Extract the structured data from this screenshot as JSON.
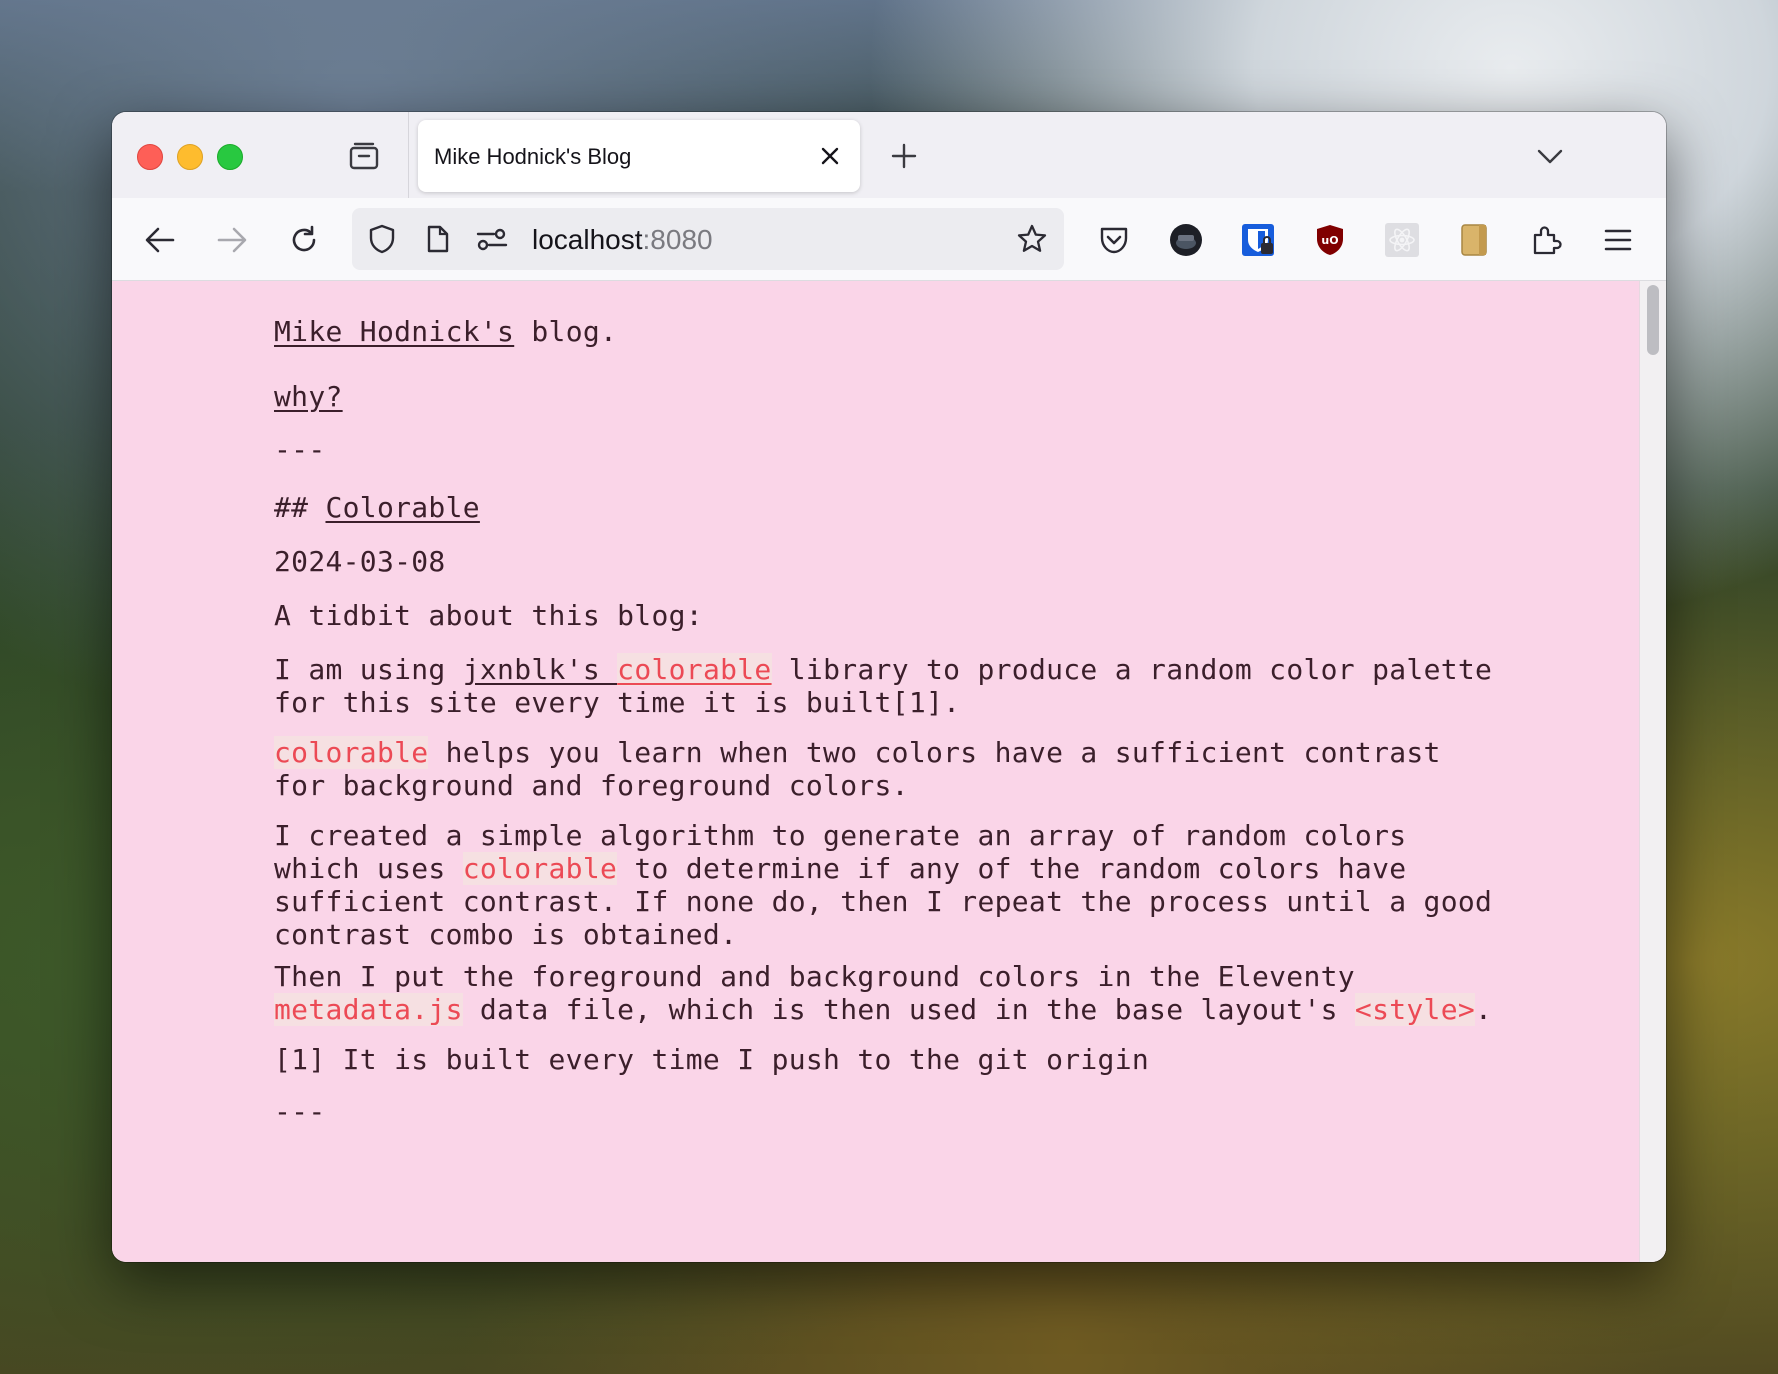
{
  "browser": {
    "tab": {
      "title": "Mike Hodnick's Blog"
    },
    "url": {
      "host": "localhost",
      "port": ":8080"
    }
  },
  "icons": [
    "tab-view-icon",
    "close-icon",
    "plus-icon",
    "chevron-down-icon",
    "back-arrow-icon",
    "forward-arrow-icon",
    "reload-icon",
    "shield-icon",
    "page-icon",
    "site-settings-icon",
    "star-icon",
    "pocket-icon",
    "avatar-icon",
    "bitwarden-icon",
    "ublock-icon",
    "react-devtools-icon",
    "notebook-icon",
    "puzzle-icon",
    "hamburger-menu-icon"
  ],
  "page": {
    "site_link": "Mike Hodnick's",
    "site_suffix": " blog.",
    "why_link": "why?",
    "hr1": "---",
    "heading_prefix": "## ",
    "heading_link": "Colorable",
    "date": "2024-03-08",
    "intro": "A tidbit about this blog:",
    "p1": {
      "a": "I am using ",
      "author_link": "jxnblk's",
      "space": " ",
      "lib_link": "colorable",
      "b": " library to produce a random color palette\nfor this site every time it is built[1]."
    },
    "p2": {
      "code": "colorable",
      "rest": " helps you learn when two colors have a sufficient contrast\nfor background and foreground colors."
    },
    "p3": {
      "a": "I created a simple algorithm to generate an array of random colors\nwhich uses ",
      "code": "colorable",
      "b": " to determine if any of the random colors have\nsufficient contrast. If none do, then I repeat the process until a good\ncontrast combo is obtained."
    },
    "p4": {
      "a": "Then I put the foreground and background colors in the Eleventy\n",
      "code1": "metadata.js",
      "b": " data file, which is then used in the base layout's ",
      "code2": "<style>",
      "c": "."
    },
    "footnote": "[1] It is built every time I push to the git origin",
    "hr2": "---"
  },
  "colors": {
    "page_bg": "#fad5e8",
    "text": "#3b1f2b",
    "code": "#ec4a55"
  }
}
